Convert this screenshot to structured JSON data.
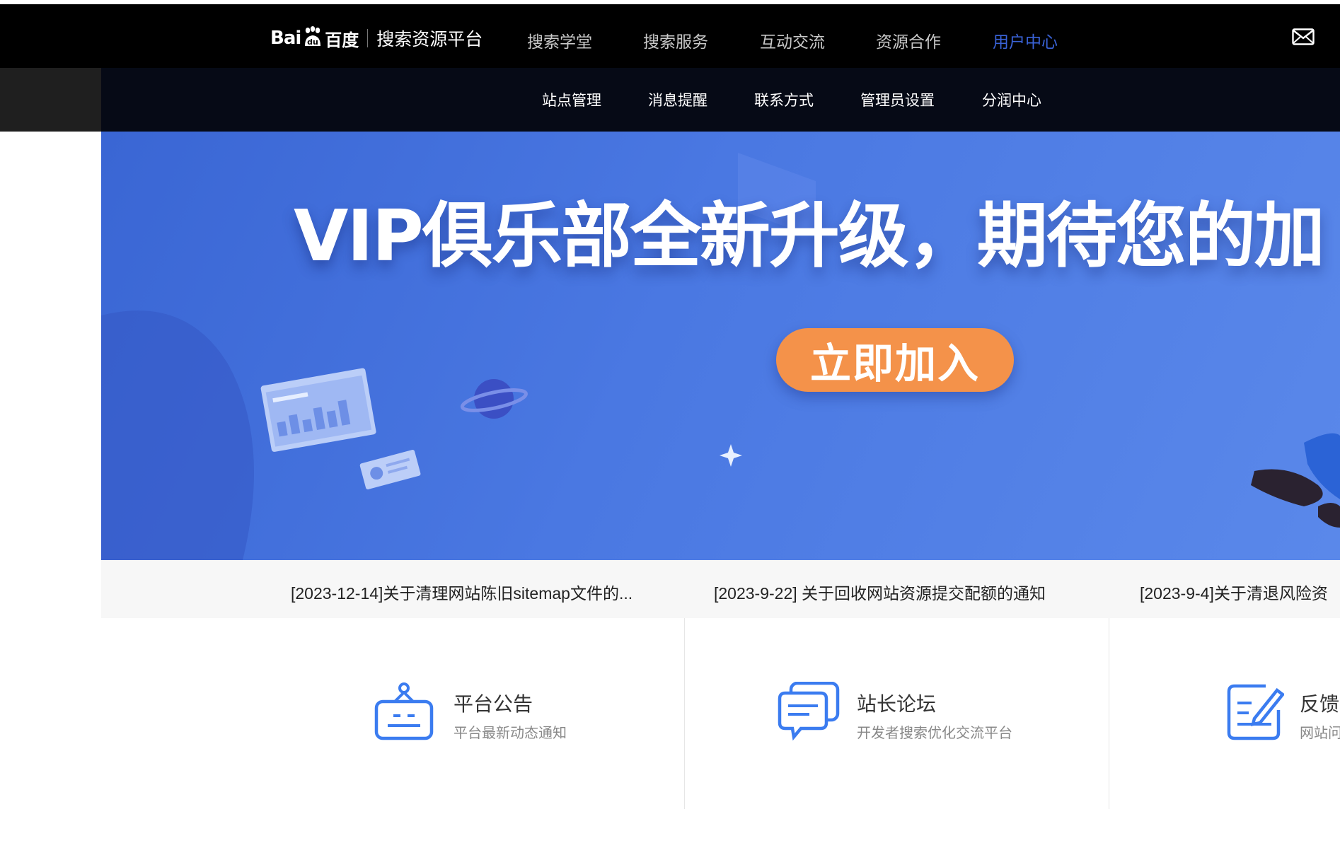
{
  "header": {
    "logo_bai": "Bai",
    "logo_cn": "百度",
    "platform_name": "搜索资源平台",
    "nav": [
      {
        "label": "搜索学堂"
      },
      {
        "label": "搜索服务"
      },
      {
        "label": "互动交流"
      },
      {
        "label": "资源合作"
      },
      {
        "label": "用户中心",
        "active": true
      }
    ],
    "mail_icon": "mail-icon"
  },
  "subnav": {
    "items": [
      {
        "label": "站点管理"
      },
      {
        "label": "消息提醒"
      },
      {
        "label": "联系方式"
      },
      {
        "label": "管理员设置"
      },
      {
        "label": "分润中心"
      }
    ]
  },
  "banner": {
    "title": "VIP俱乐部全新升级，期待您的加",
    "button": "立即加入"
  },
  "notices": [
    {
      "text": "[2023-12-14]关于清理网站陈旧sitemap文件的..."
    },
    {
      "text": "[2023-9-22] 关于回收网站资源提交配额的通知"
    },
    {
      "text": "[2023-9-4]关于清退风险资"
    }
  ],
  "cards": [
    {
      "title": "平台公告",
      "desc": "平台最新动态通知",
      "icon": "announcement-icon"
    },
    {
      "title": "站长论坛",
      "desc": "开发者搜索优化交流平台",
      "icon": "forum-chat-icon"
    },
    {
      "title": "反馈",
      "desc": "网站问",
      "icon": "feedback-edit-icon"
    }
  ],
  "colors": {
    "topbar": "#000000",
    "subbar": "#060a16",
    "active_nav": "#3a63d8",
    "banner": "#4a78e2",
    "button": "#f4924a",
    "icon_blue": "#3b7cf0"
  }
}
